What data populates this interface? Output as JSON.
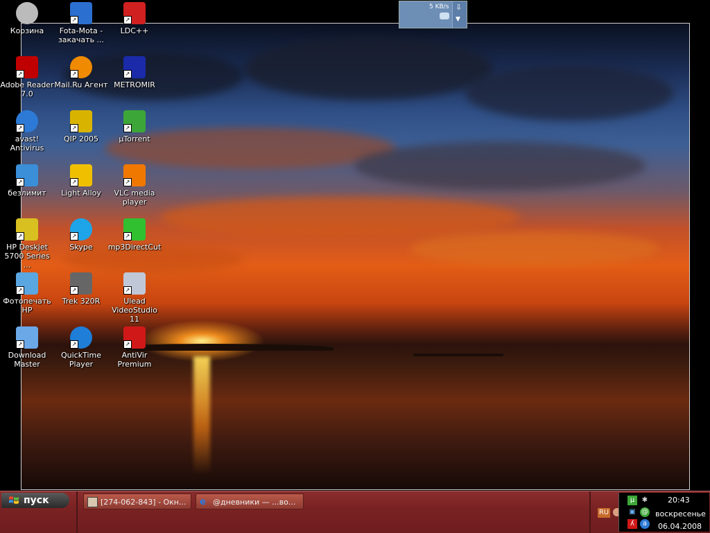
{
  "desktop": {
    "icons": [
      {
        "id": "recycle",
        "label": "Корзина",
        "glyph": "recycle-bin-icon",
        "color": "#bbbbbb",
        "shortcut": false
      },
      {
        "id": "fotamota",
        "label": "Fota-Mota - закачать ...",
        "glyph": "fota-mota-icon",
        "color": "#2b6fd0",
        "shortcut": true
      },
      {
        "id": "ldc",
        "label": "LDC++",
        "glyph": "ldc-icon",
        "color": "#d02020",
        "shortcut": true
      },
      {
        "id": "adobe",
        "label": "Adobe Reader 7.0",
        "glyph": "adobe-reader-icon",
        "color": "#c00000",
        "shortcut": true
      },
      {
        "id": "mailru",
        "label": "Mail.Ru Агент",
        "glyph": "mailru-agent-icon",
        "color": "#f08a00",
        "shortcut": true
      },
      {
        "id": "metromir",
        "label": "METROMIR",
        "glyph": "metromir-icon",
        "color": "#1a2aa8",
        "shortcut": true
      },
      {
        "id": "avast",
        "label": "avast! Antivirus",
        "glyph": "avast-icon",
        "color": "#2d7ad6",
        "shortcut": true
      },
      {
        "id": "qip",
        "label": "QIP 2005",
        "glyph": "qip-icon",
        "color": "#d8b400",
        "shortcut": true
      },
      {
        "id": "utorrent",
        "label": "µTorrent",
        "glyph": "utorrent-icon",
        "color": "#3da638",
        "shortcut": true
      },
      {
        "id": "bezlimit",
        "label": "безлимит",
        "glyph": "network-connection-icon",
        "color": "#3b8ed8",
        "shortcut": true
      },
      {
        "id": "lightalloy",
        "label": "Light Alloy",
        "glyph": "light-alloy-icon",
        "color": "#f0c000",
        "shortcut": true
      },
      {
        "id": "vlc",
        "label": "VLC media player",
        "glyph": "vlc-icon",
        "color": "#f07800",
        "shortcut": true
      },
      {
        "id": "hpdeskjet",
        "label": "HP Deskjet 5700 Series ...",
        "glyph": "printer-icon",
        "color": "#d8c020",
        "shortcut": true
      },
      {
        "id": "skype",
        "label": "Skype",
        "glyph": "skype-icon",
        "color": "#1ea4e8",
        "shortcut": true
      },
      {
        "id": "mp3dc",
        "label": "mp3DirectCut",
        "glyph": "mp3directcut-icon",
        "color": "#30c030",
        "shortcut": true
      },
      {
        "id": "fotopechat",
        "label": "Фотопечать HP",
        "glyph": "photo-print-icon",
        "color": "#5aa6e0",
        "shortcut": true
      },
      {
        "id": "trek",
        "label": "Trek 320R",
        "glyph": "camera-icon",
        "color": "#666666",
        "shortcut": true
      },
      {
        "id": "ulead",
        "label": "Ulead VideoStudio 11",
        "glyph": "ulead-icon",
        "color": "#c0c8d8",
        "shortcut": true
      },
      {
        "id": "dlmaster",
        "label": "Download Master",
        "glyph": "download-master-icon",
        "color": "#6aa8e8",
        "shortcut": true
      },
      {
        "id": "quicktime",
        "label": "QuickTime Player",
        "glyph": "quicktime-icon",
        "color": "#1e7ed8",
        "shortcut": true
      },
      {
        "id": "antivir",
        "label": "AntiVir Premium",
        "glyph": "antivir-icon",
        "color": "#d01818",
        "shortcut": true
      }
    ]
  },
  "netmeter": {
    "rate": "5 KB/s"
  },
  "taskbar": {
    "start_label": "пуск",
    "tasks": [
      {
        "label": "[274-062-843] - Окн...",
        "icon": "chat-window-icon"
      },
      {
        "label": "@дневники — ...во...",
        "icon": "internet-explorer-icon"
      }
    ],
    "lang": "RU",
    "tray": {
      "time": "20:43",
      "day": "воскресенье",
      "date": "06.04.2008"
    }
  },
  "colors": {
    "taskbar": "#7a2223",
    "accent": "#c76a2a"
  }
}
